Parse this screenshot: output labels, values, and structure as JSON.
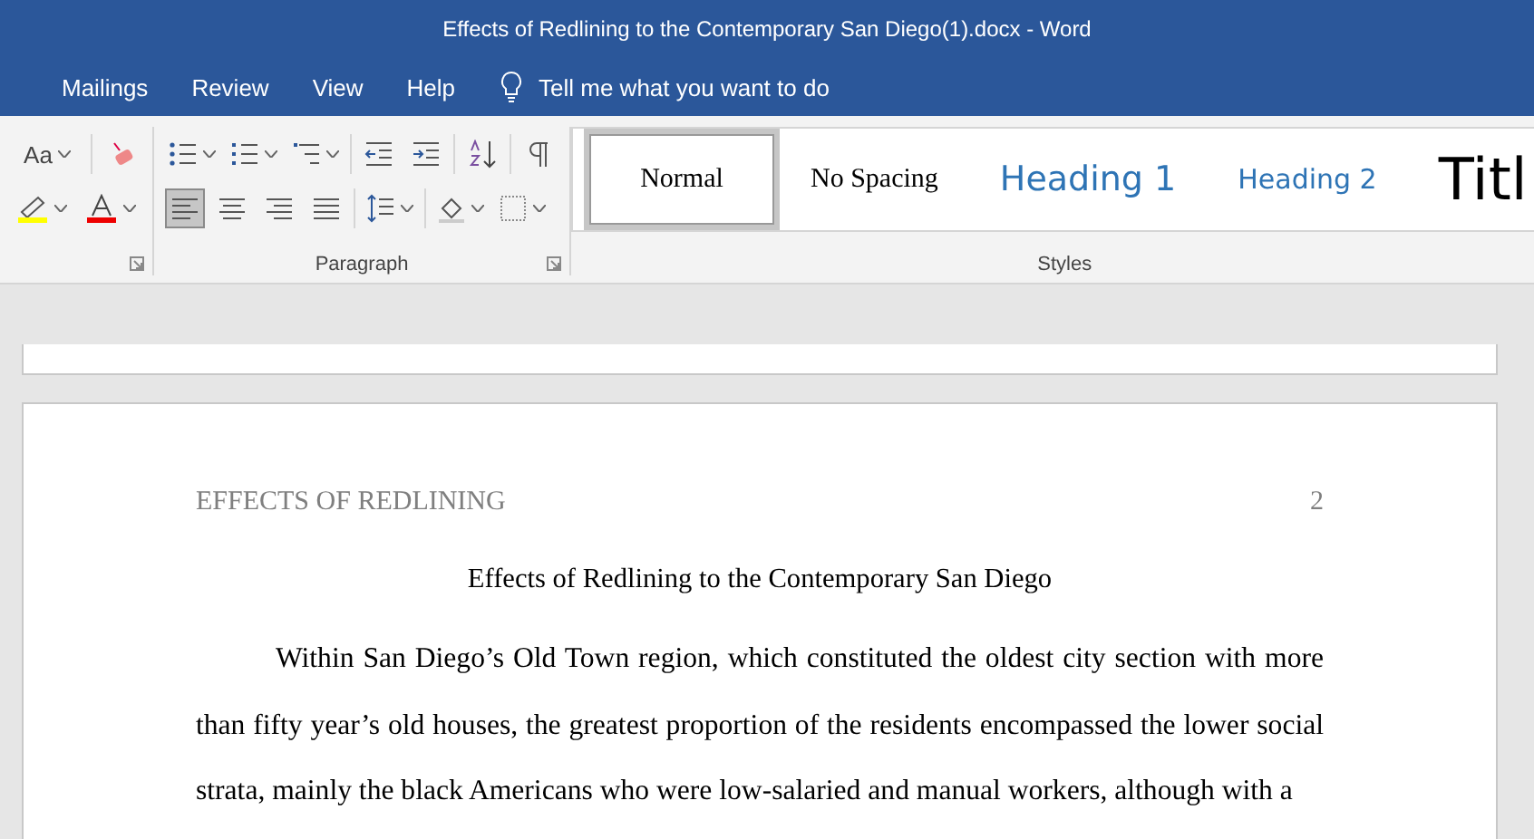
{
  "window": {
    "title": "Effects of Redlining to the Contemporary San Diego(1).docx  -  Word"
  },
  "tabs": [
    {
      "label": "Mailings",
      "selected": false
    },
    {
      "label": "Review",
      "selected": false
    },
    {
      "label": "View",
      "selected": false
    },
    {
      "label": "Help",
      "selected": false
    }
  ],
  "tell_me": {
    "placeholder": "Tell me what you want to do"
  },
  "font_group": {
    "change_case": "Aa"
  },
  "paragraph_group": {
    "label": "Paragraph",
    "alignment": [
      {
        "kind": "left",
        "selected": true
      },
      {
        "kind": "center",
        "selected": false
      },
      {
        "kind": "right",
        "selected": false
      },
      {
        "kind": "justify",
        "selected": false
      }
    ]
  },
  "styles_group": {
    "label": "Styles",
    "styles": [
      {
        "label": "Normal",
        "kind": "normal",
        "selected": true
      },
      {
        "label": "No Spacing",
        "kind": "nospacing",
        "selected": false
      },
      {
        "label": "Heading 1",
        "kind": "heading1",
        "selected": false
      },
      {
        "label": "Heading 2",
        "kind": "heading2",
        "selected": false
      },
      {
        "label": "Titl",
        "kind": "title",
        "selected": false
      }
    ]
  },
  "document": {
    "header": "EFFECTS OF REDLINING",
    "page_number": "2",
    "title": "Effects of Redlining to the Contemporary San Diego",
    "paragraph": "Within San Diego’s Old Town region, which constituted the oldest city section with more than fifty year’s old houses, the greatest proportion of the residents encompassed the lower social strata, mainly the black Americans who were low-salaried and manual workers, although with a"
  }
}
